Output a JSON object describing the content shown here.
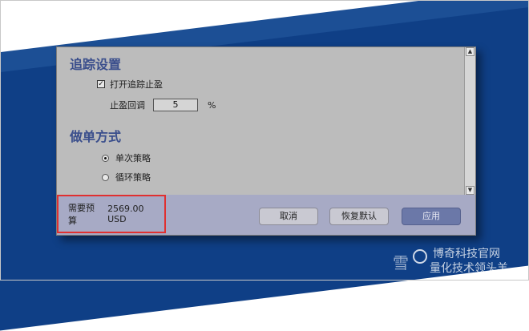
{
  "tracking_section": {
    "title": "追踪设置",
    "trailing_stop_label": "打开追踪止盈",
    "trailing_stop_checked": true,
    "retrace_label": "止盈回调",
    "retrace_value": "5",
    "retrace_unit": "%"
  },
  "order_section": {
    "title": "做单方式",
    "options": [
      {
        "label": "单次策略",
        "selected": true
      },
      {
        "label": "循环策略",
        "selected": false
      }
    ]
  },
  "footer": {
    "budget_label": "需要预算",
    "budget_value": "2569.00 USD",
    "cancel_label": "取消",
    "reset_label": "恢复默认",
    "apply_label": "应用"
  },
  "watermark": {
    "line1": "博奇科技官网",
    "line2": "雪",
    "line3": "量化技术领头羊"
  },
  "colors": {
    "section_title": "#3a4e8c",
    "footer_bg": "#a7aac5",
    "apply_button": "#6b78a8",
    "highlight_border": "#e03030",
    "slide_band": "#1c4f95"
  }
}
